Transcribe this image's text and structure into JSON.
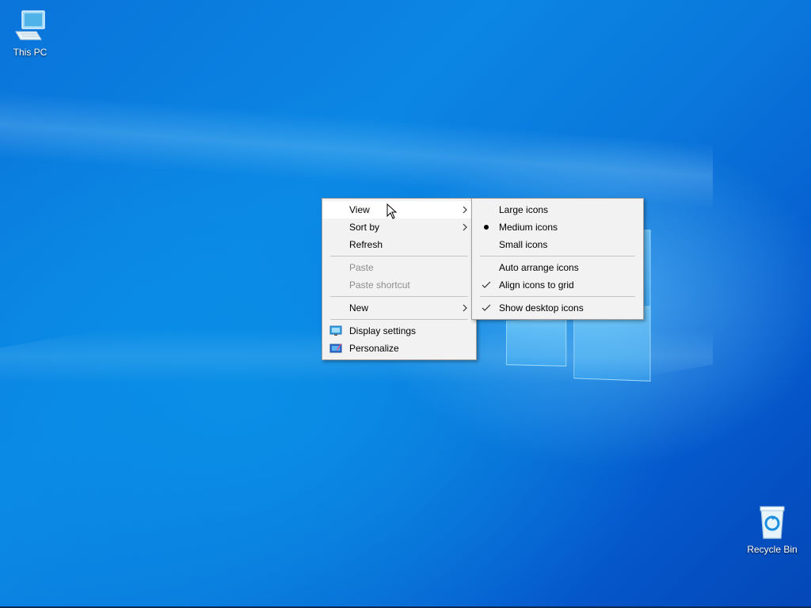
{
  "desktop": {
    "icons": [
      {
        "label": "This PC",
        "icon": "computer-icon"
      },
      {
        "label": "Recycle Bin",
        "icon": "recycle-bin-icon"
      }
    ]
  },
  "context_menu": {
    "items": [
      {
        "label": "View",
        "submenu": true,
        "highlighted": true
      },
      {
        "label": "Sort by",
        "submenu": true
      },
      {
        "label": "Refresh"
      },
      {
        "label": "Paste",
        "disabled": true
      },
      {
        "label": "Paste shortcut",
        "disabled": true
      },
      {
        "label": "New",
        "submenu": true
      },
      {
        "label": "Display settings",
        "icon": "display-settings-icon"
      },
      {
        "label": "Personalize",
        "icon": "personalize-icon"
      }
    ]
  },
  "view_submenu": {
    "items": [
      {
        "label": "Large icons"
      },
      {
        "label": "Medium icons",
        "mark": "bullet"
      },
      {
        "label": "Small icons"
      },
      {
        "label": "Auto arrange icons"
      },
      {
        "label": "Align icons to grid",
        "mark": "check"
      },
      {
        "label": "Show desktop icons",
        "mark": "check"
      }
    ]
  },
  "colors": {
    "desktop_blue": "#0a78dc",
    "menu_background": "#f2f2f2",
    "menu_hover": "#ffffff",
    "disabled_text": "#8d8d8d"
  }
}
